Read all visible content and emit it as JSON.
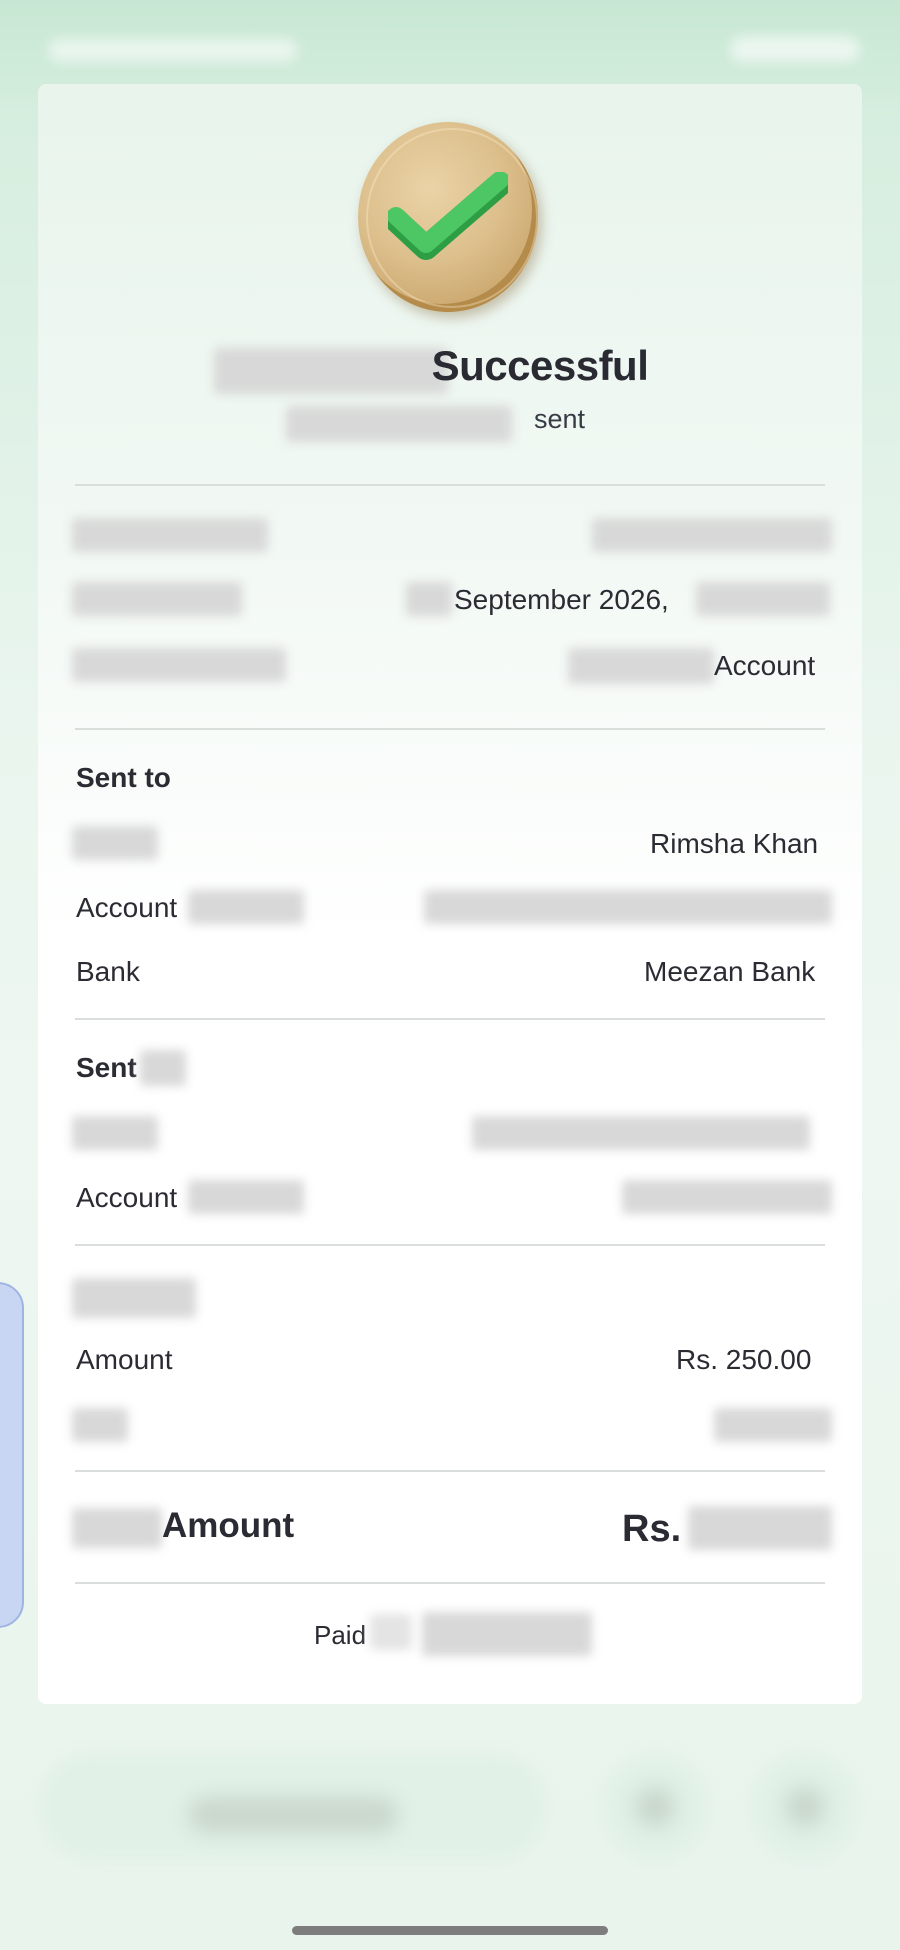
{
  "receipt": {
    "title_suffix": "Successful",
    "subtitle_suffix": "sent",
    "details": {
      "date_value": "September 2026,",
      "account_value_suffix": "Account"
    },
    "sent_to": {
      "heading": "Sent to",
      "name": "Rimsha Khan",
      "account_label": "Account",
      "bank_label": "Bank",
      "bank_value": "Meezan Bank"
    },
    "sent_from": {
      "heading": "Sent",
      "account_label": "Account"
    },
    "amounts": {
      "amount_label": "Amount",
      "amount_value": "Rs. 250.00",
      "total_label": "Amount",
      "total_prefix": "Rs."
    },
    "footer": {
      "paid_label": "Paid"
    }
  }
}
